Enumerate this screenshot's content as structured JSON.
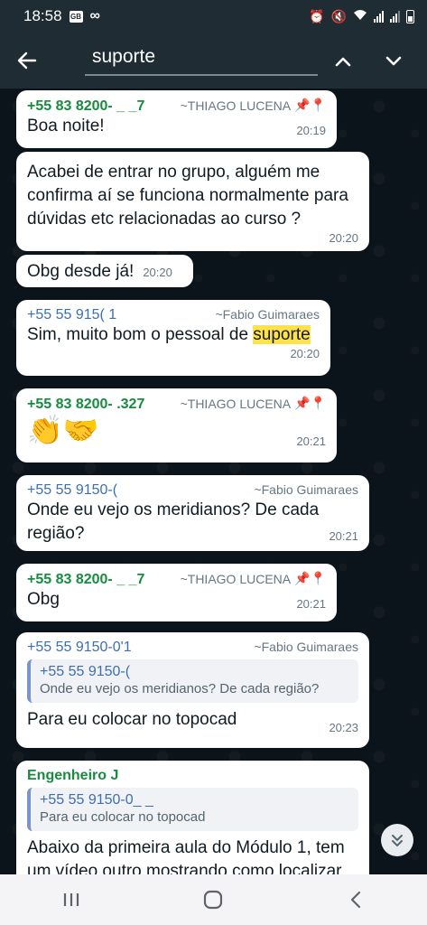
{
  "status_bar": {
    "time": "18:58",
    "icons": [
      "gallery-badge-icon",
      "infinity-icon",
      "alarm-icon",
      "mute-icon",
      "wifi-icon",
      "signal-icon",
      "battery-icon"
    ]
  },
  "search": {
    "query": "suporte",
    "icons": {
      "back": "arrow-left-icon",
      "up": "chevron-up-icon",
      "down": "chevron-down-icon"
    }
  },
  "messages": [
    {
      "phone": "+55 83 8200- _ _7",
      "name": "~THIAGO LUCENA",
      "pins": "📌📍",
      "text": "Boa noite!",
      "time": "20:19"
    },
    {
      "text": "Acabei de entrar no grupo, alguém me confirma aí se funciona normalmente para dúvidas etc relacionadas ao curso ?",
      "time": "20:20"
    },
    {
      "text": "Obg desde já!",
      "time": "20:20"
    },
    {
      "phone": "+55 55 915(  1",
      "name": "~Fabio Guimaraes",
      "text_before": "Sim, muito bom o pessoal de ",
      "highlight": "suporte",
      "time": "20:20"
    },
    {
      "phone": "+55 83 8200- .327",
      "name": "~THIAGO LUCENA",
      "pins": "📌📍",
      "emoji": "👏🤝",
      "time": "20:21"
    },
    {
      "phone": "+55 55 9150-(",
      "name": "~Fabio Guimaraes",
      "text": "Onde eu vejo os meridianos? De cada região?",
      "time": "20:21"
    },
    {
      "phone": "+55 83 8200- _ _7",
      "name": "~THIAGO LUCENA",
      "pins": "📌📍",
      "text": "Obg",
      "time": "20:21"
    },
    {
      "phone": "+55 55 9150-0'1",
      "name": "~Fabio Guimaraes",
      "quote_phone": "+55 55 9150-(",
      "quote_text": "Onde eu vejo os meridianos? De cada região?",
      "text": "Para eu colocar no topocad",
      "time": "20:23"
    },
    {
      "phone": "Engenheiro J",
      "quote_phone": "+55 55 9150-0_ _",
      "quote_text": "Para eu colocar no topocad",
      "text": "Abaixo da primeira aula do Módulo 1, tem um vídeo outro mostrando como localizar"
    }
  ],
  "colors": {
    "bubble": "#ffffff",
    "background": "#0b141a",
    "header": "#1f2c34",
    "green_name": "#168c3f",
    "blue_name": "#3c6fb0",
    "highlight": "#ffe24a"
  },
  "nav": {
    "icons": [
      "recent-apps-icon",
      "home-icon",
      "back-icon"
    ]
  }
}
